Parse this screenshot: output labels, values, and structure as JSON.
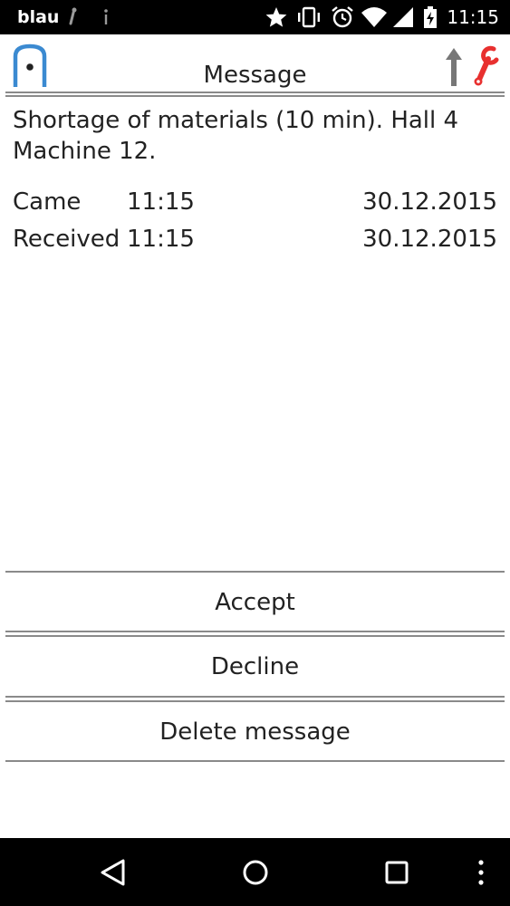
{
  "status_bar": {
    "carrier": "blau",
    "time": "11:15",
    "icons": [
      "wrench-notification-icon",
      "info-notification-icon",
      "star-icon",
      "vibrate-icon",
      "alarm-icon",
      "wifi-icon",
      "signal-icon",
      "battery-charging-icon"
    ]
  },
  "header": {
    "title": "Message",
    "logo_icon": "app-logo-icon",
    "right_icons": [
      "upload-arrow-icon",
      "wrench-icon"
    ],
    "colors": {
      "logo": "#3b8ad1",
      "wrench": "#e8302f",
      "arrow": "#777777"
    }
  },
  "message": {
    "text": "Shortage of materials (10 min). Hall 4 Machine 12.",
    "details": [
      {
        "label": "Came",
        "time": "11:15",
        "date": "30.12.2015"
      },
      {
        "label": "Received",
        "time": "11:15",
        "date": "30.12.2015"
      }
    ]
  },
  "actions": {
    "accept": "Accept",
    "decline": "Decline",
    "delete": "Delete message"
  },
  "nav_bar": {
    "icons": [
      "back-icon",
      "home-icon",
      "recents-icon",
      "overflow-menu-icon"
    ]
  }
}
